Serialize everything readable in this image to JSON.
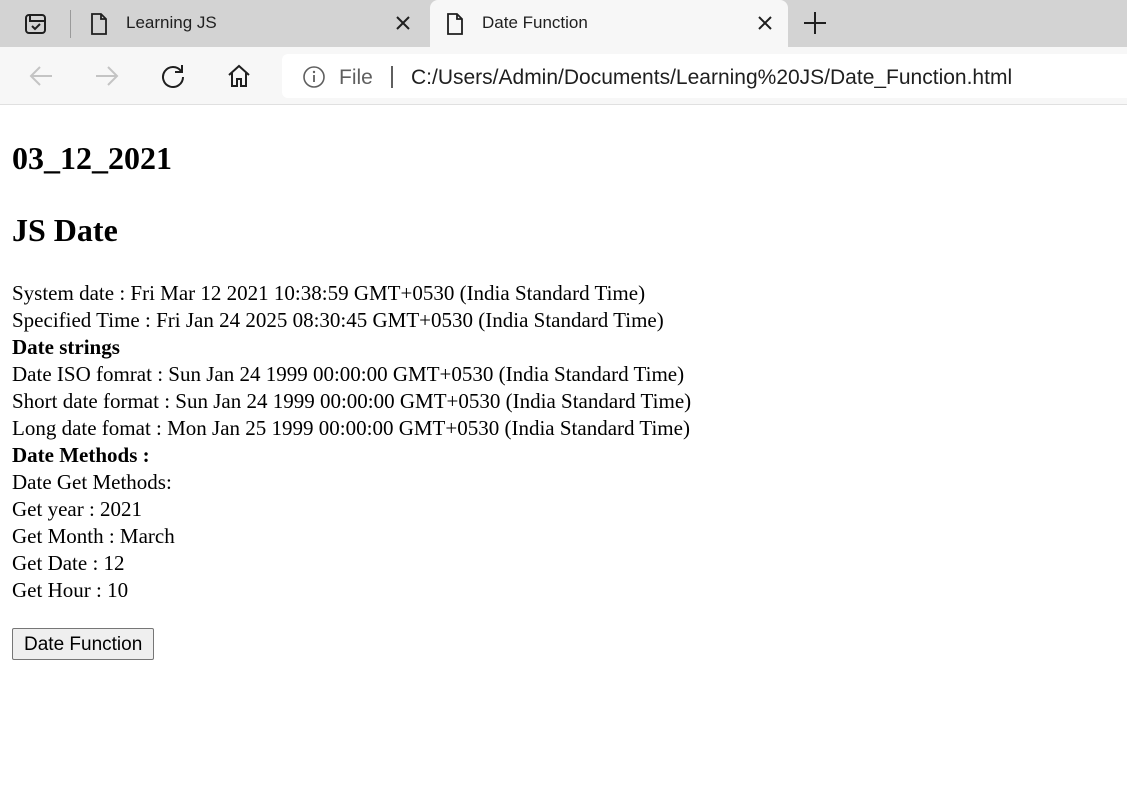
{
  "browser": {
    "tabs": [
      {
        "title": "Learning JS",
        "active": false
      },
      {
        "title": "Date Function",
        "active": true
      }
    ],
    "address": {
      "scheme": "File",
      "url": "C:/Users/Admin/Documents/Learning%20JS/Date_Function.html"
    },
    "icons": {
      "tab_actions": "tab-actions-icon",
      "favicon": "page-icon",
      "close": "close-icon",
      "new_tab": "plus-icon",
      "back": "back-arrow-icon",
      "forward": "forward-arrow-icon",
      "refresh": "refresh-icon",
      "home": "home-icon",
      "info": "info-icon"
    }
  },
  "page": {
    "heading_date": "03_12_2021",
    "heading_title": "JS Date",
    "lines": {
      "system_date": "System date : Fri Mar 12 2021 10:38:59 GMT+0530 (India Standard Time)",
      "specified_time": "Specified Time : Fri Jan 24 2025 08:30:45 GMT+0530 (India Standard Time)",
      "date_strings": "Date strings",
      "iso_format": "Date ISO fomrat : Sun Jan 24 1999 00:00:00 GMT+0530 (India Standard Time)",
      "short_format": "Short date format : Sun Jan 24 1999 00:00:00 GMT+0530 (India Standard Time)",
      "long_format": "Long date fomat : Mon Jan 25 1999 00:00:00 GMT+0530 (India Standard Time)",
      "date_methods": "Date Methods :",
      "get_methods": "Date Get Methods:",
      "get_year": "Get year : 2021",
      "get_month": "Get Month : March",
      "get_date": "Get Date : 12",
      "get_hour": "Get Hour : 10"
    },
    "button_label": "Date Function"
  }
}
